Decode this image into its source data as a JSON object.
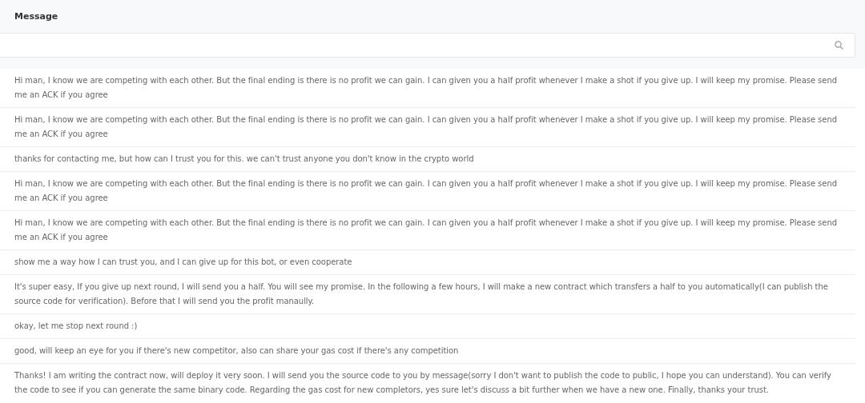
{
  "header": {
    "title": "Message"
  },
  "messages": [
    "Hi man, I know we are competing with each other. But the final ending is there is no profit we can gain. I can given you a half profit whenever I make a shot if you give up. I will keep my promise. Please send me an ACK if you agree",
    "Hi man, I know we are competing with each other. But the final ending is there is no profit we can gain. I can given you a half profit whenever I make a shot if you give up. I will keep my promise. Please send me an ACK if you agree",
    "thanks for contacting me, but how can I trust you for this. we can't trust anyone you don't know in the crypto world",
    "Hi man, I know we are competing with each other. But the final ending is there is no profit we can gain. I can given you a half profit whenever I make a shot if you give up. I will keep my promise. Please send me an ACK if you agree",
    "Hi man, I know we are competing with each other. But the final ending is there is no profit we can gain. I can given you a half profit whenever I make a shot if you give up. I will keep my promise. Please send me an ACK if you agree",
    "show me a way how I can trust you, and I can give up for this bot, or even cooperate",
    "It's super easy, If you give up next round, I will send you a half. You will see my promise. In the following a few hours, I will make a new contract which transfers a half to you automatically(I can publish the source code for verification). Before that I will send you the profit manaully.",
    "okay, let me stop next round :)",
    "good, will keep an eye for you if there's new competitor, also can share your gas cost if there's any competition",
    "Thanks! I am writing the contract now, will deploy it very soon. I will send you the source code to you by message(sorry I don't want to publish the code to public, I hope you can understand). You can verify the code to see if you can generate the same binary code. Regarding the gas cost for new completors, yes sure let's discuss a bit further when we have a new one. Finally, thanks your trust."
  ]
}
